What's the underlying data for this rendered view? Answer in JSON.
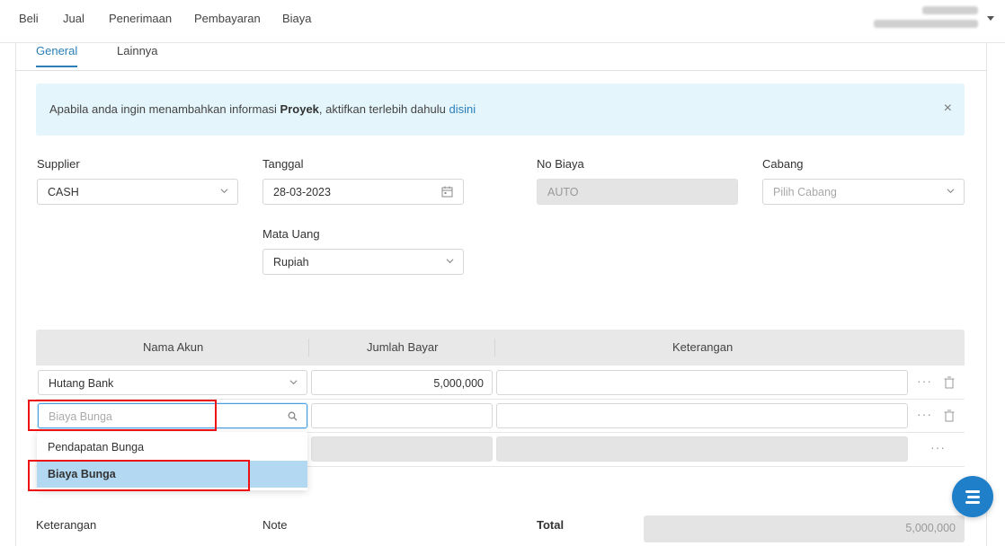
{
  "nav": {
    "items": [
      "Beli",
      "Jual",
      "Penerimaan",
      "Pembayaran",
      "Biaya"
    ]
  },
  "tabs": [
    {
      "label": "General",
      "active": true
    },
    {
      "label": "Lainnya",
      "active": false
    }
  ],
  "alert": {
    "text_before": "Apabila anda ingin menambahkan informasi ",
    "bold": "Proyek",
    "text_after": ", aktifkan terlebih dahulu ",
    "link": "disini",
    "close": "×"
  },
  "form": {
    "supplier": {
      "label": "Supplier",
      "value": "CASH"
    },
    "tanggal": {
      "label": "Tanggal",
      "value": "28-03-2023"
    },
    "no_biaya": {
      "label": "No Biaya",
      "value": "AUTO"
    },
    "cabang": {
      "label": "Cabang",
      "placeholder": "Pilih Cabang"
    },
    "mata_uang": {
      "label": "Mata Uang",
      "value": "Rupiah"
    }
  },
  "table": {
    "headers": [
      "Nama Akun",
      "Jumlah Bayar",
      "Keterangan"
    ],
    "rows": [
      {
        "akun": "Hutang Bank",
        "jumlah": "5,000,000",
        "keterangan": ""
      },
      {
        "akun_placeholder": "Biaya Bunga",
        "jumlah": "",
        "keterangan": ""
      }
    ]
  },
  "dropdown": {
    "options": [
      {
        "label": "Pendapatan Bunga",
        "selected": false
      },
      {
        "label": "Biaya Bunga",
        "selected": true
      }
    ]
  },
  "bottom": {
    "keterangan_label": "Keterangan",
    "note_label": "Note",
    "total_label": "Total",
    "total_value": "5,000,000"
  },
  "colors": {
    "accent": "#2a7fb8",
    "highlight": "#e11111",
    "alert_bg": "#e4f5fc",
    "selected_bg": "#b3d9f2"
  }
}
